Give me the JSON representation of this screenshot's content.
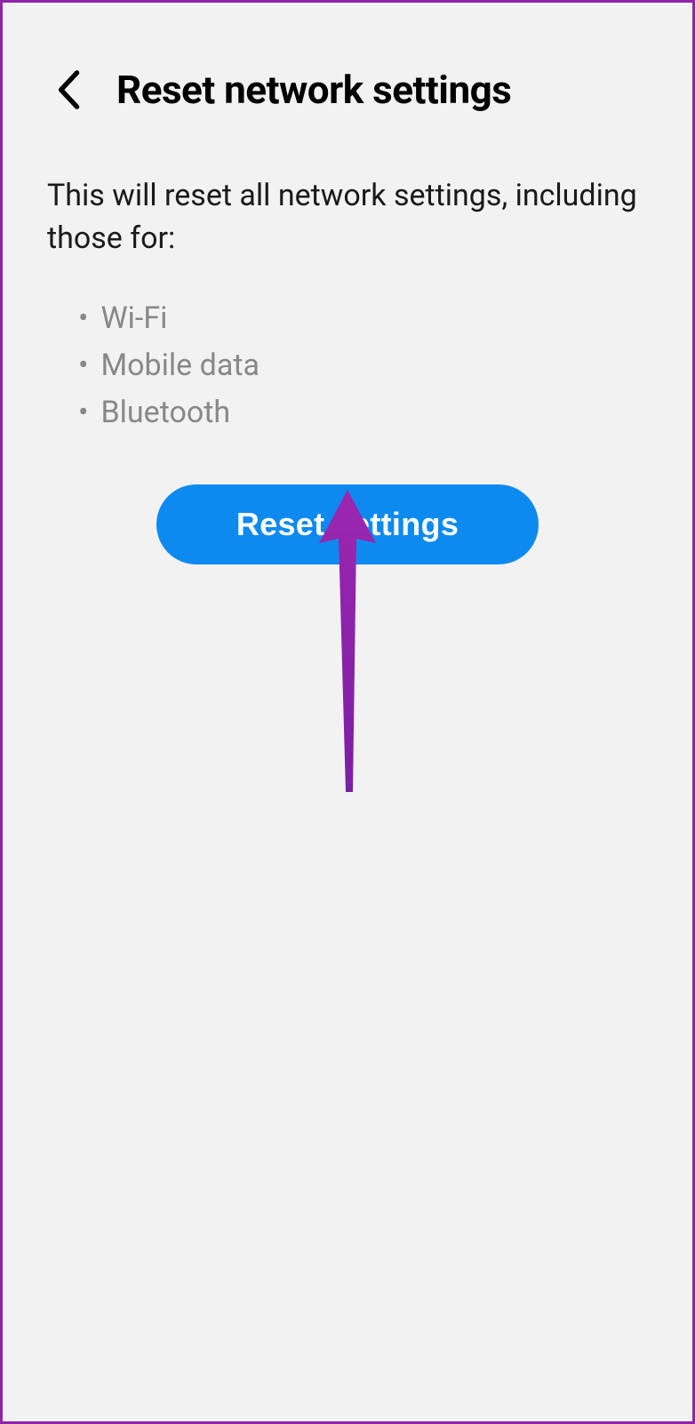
{
  "header": {
    "title": "Reset network settings"
  },
  "description": "This will reset all network settings, including those for:",
  "list": {
    "items": [
      "Wi-Fi",
      "Mobile data",
      "Bluetooth"
    ]
  },
  "button": {
    "label": "Reset settings"
  }
}
